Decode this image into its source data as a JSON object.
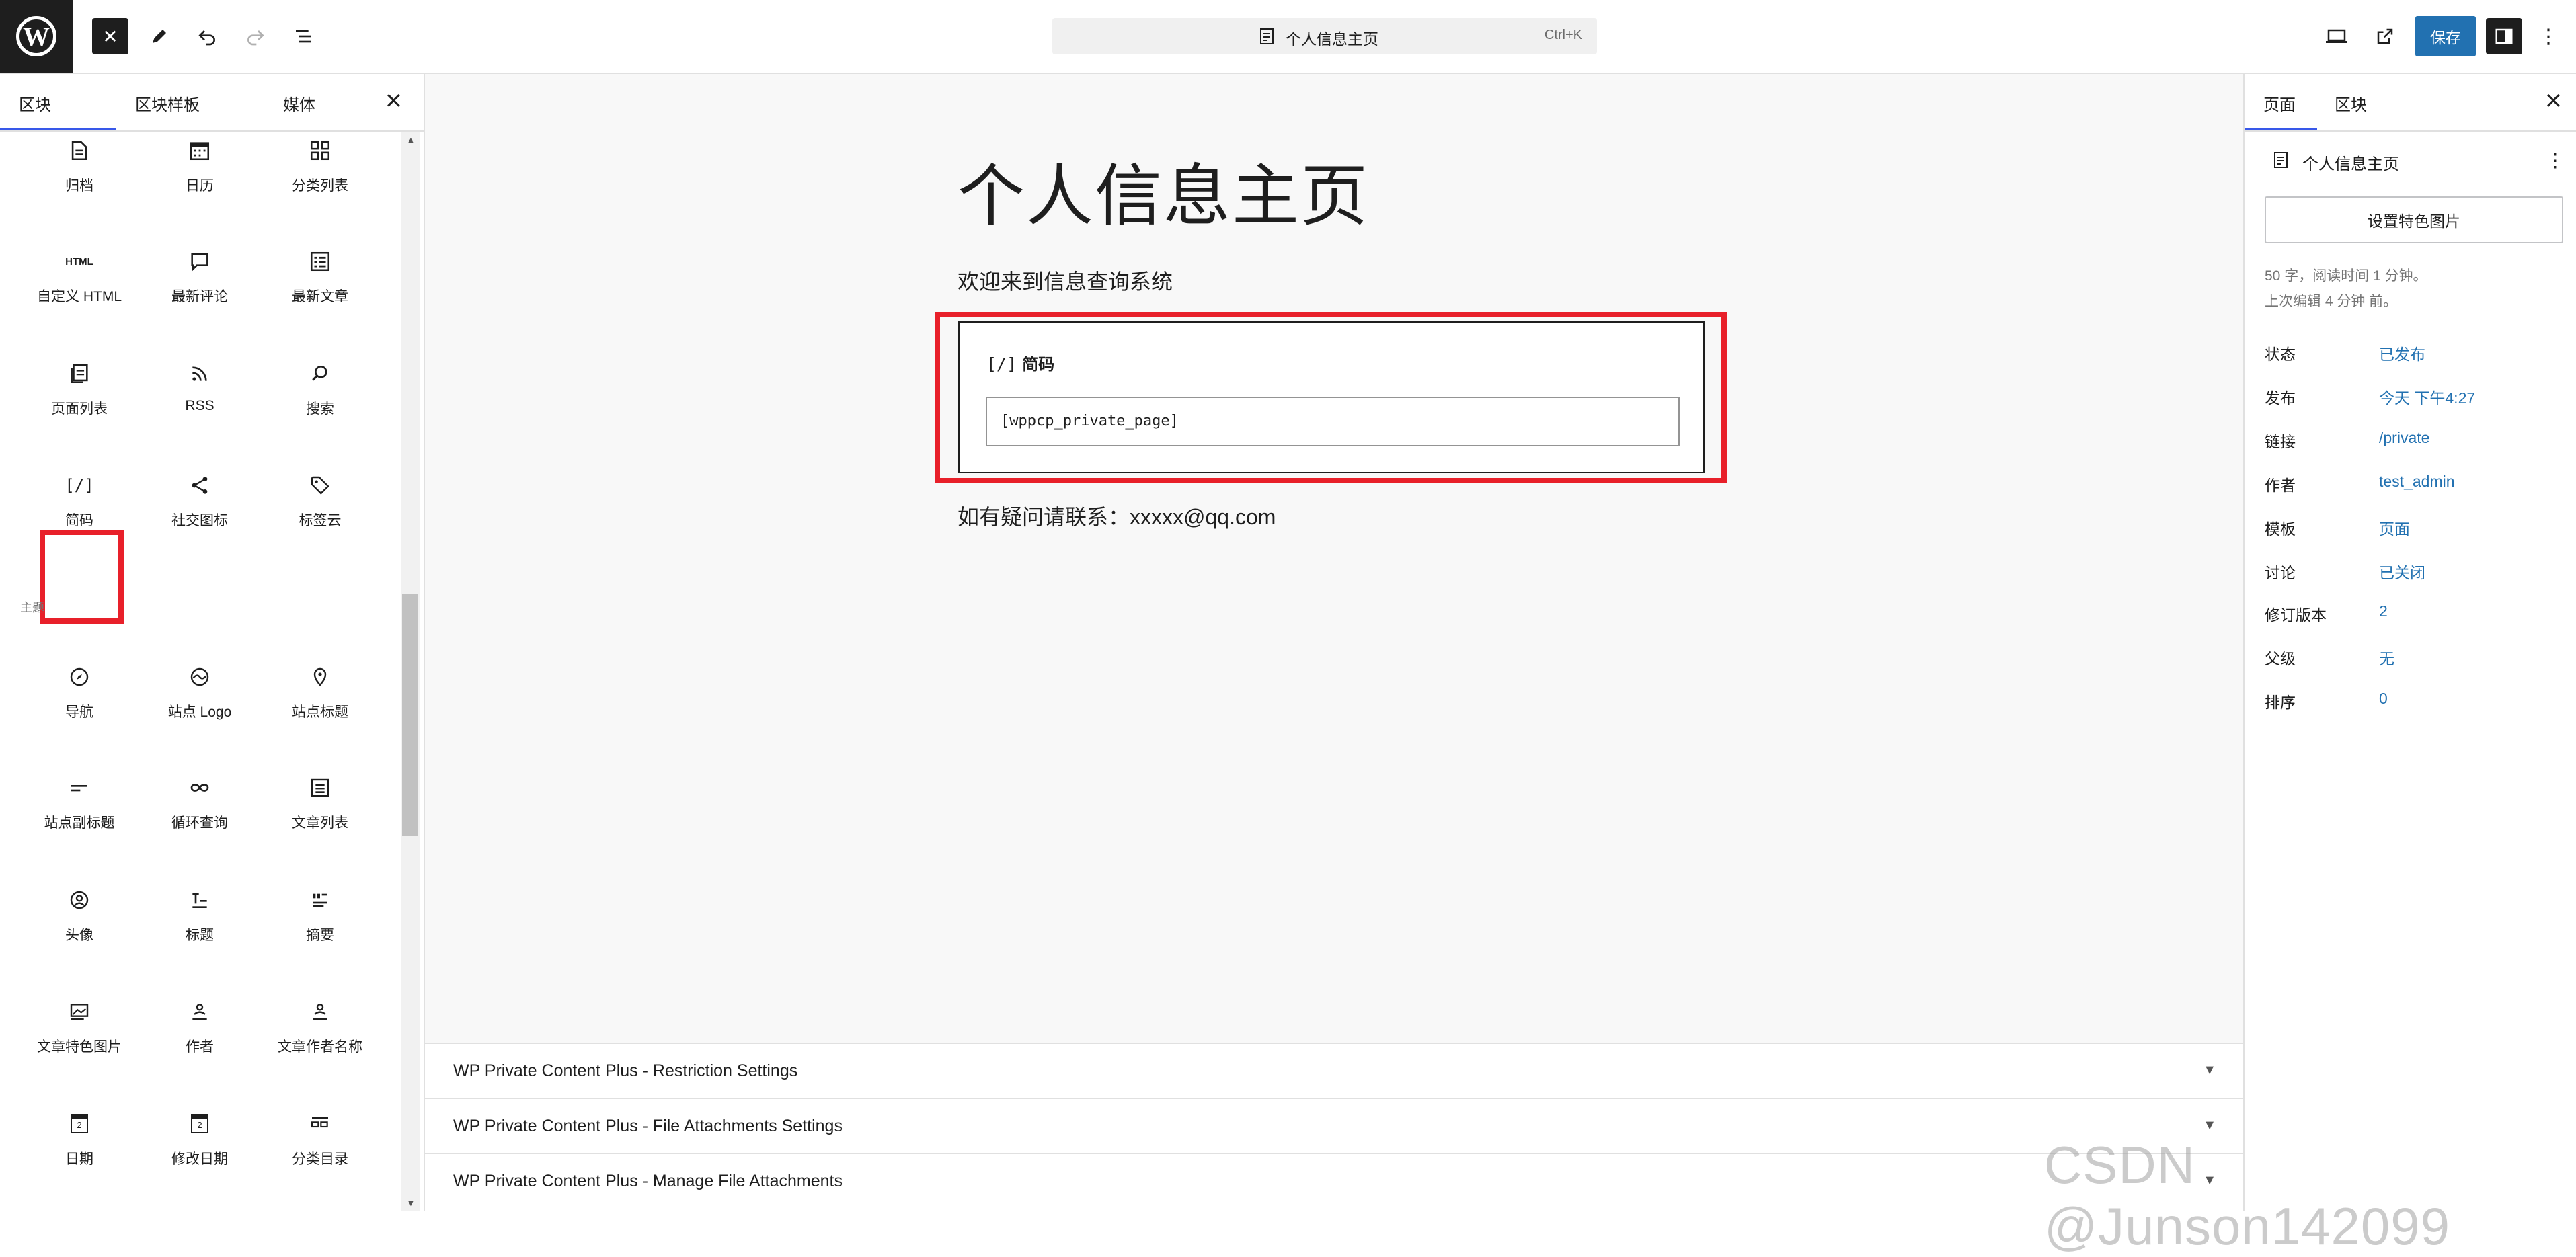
{
  "topbar": {
    "close_glyph": "✕",
    "command": {
      "title": "个人信息主页",
      "shortcut": "Ctrl+K"
    },
    "save_label": "保存"
  },
  "inserter": {
    "tabs": [
      "区块",
      "区块样板",
      "媒体"
    ],
    "close_glyph": "✕",
    "category_theme": "主题",
    "widgets": [
      {
        "label": "归档",
        "icon": "archive-icon"
      },
      {
        "label": "日历",
        "icon": "calendar-icon"
      },
      {
        "label": "分类列表",
        "icon": "categories-icon"
      },
      {
        "label": "自定义 HTML",
        "icon": "html-icon",
        "icon_text": "HTML"
      },
      {
        "label": "最新评论",
        "icon": "comment-icon"
      },
      {
        "label": "最新文章",
        "icon": "latest-posts-icon"
      },
      {
        "label": "页面列表",
        "icon": "page-list-icon"
      },
      {
        "label": "RSS",
        "icon": "rss-icon"
      },
      {
        "label": "搜索",
        "icon": "search-icon"
      },
      {
        "label": "简码",
        "icon": "shortcode-icon",
        "icon_text": "[/]"
      },
      {
        "label": "社交图标",
        "icon": "share-icon"
      },
      {
        "label": "标签云",
        "icon": "tag-icon"
      }
    ],
    "theme_blocks": [
      {
        "label": "导航",
        "icon": "navigation-icon"
      },
      {
        "label": "站点 Logo",
        "icon": "site-logo-icon"
      },
      {
        "label": "站点标题",
        "icon": "map-marker-icon"
      },
      {
        "label": "站点副标题",
        "icon": "tagline-icon"
      },
      {
        "label": "循环查询",
        "icon": "loop-icon"
      },
      {
        "label": "文章列表",
        "icon": "post-list-icon"
      },
      {
        "label": "头像",
        "icon": "avatar-icon"
      },
      {
        "label": "标题",
        "icon": "title-icon"
      },
      {
        "label": "摘要",
        "icon": "excerpt-icon"
      },
      {
        "label": "文章特色图片",
        "icon": "featured-image-icon"
      },
      {
        "label": "作者",
        "icon": "author-icon"
      },
      {
        "label": "文章作者名称",
        "icon": "author-name-icon"
      },
      {
        "label": "日期",
        "icon": "date-icon",
        "icon_text": "2"
      },
      {
        "label": "修改日期",
        "icon": "modified-date-icon",
        "icon_text": "2"
      },
      {
        "label": "分类目录",
        "icon": "terms-icon"
      }
    ]
  },
  "canvas": {
    "title": "个人信息主页",
    "welcome": "欢迎来到信息查询系统",
    "shortcode_block": {
      "icon_text": "[/]",
      "heading": "简码",
      "value": "[wppcp_private_page]"
    },
    "contact": "如有疑问请联系：xxxxx@qq.com"
  },
  "metaboxes": [
    "WP Private Content Plus - Restriction Settings",
    "WP Private Content Plus - File Attachments Settings",
    "WP Private Content Plus - Manage File Attachments"
  ],
  "sidebar": {
    "tabs": [
      "页面",
      "区块"
    ],
    "close_glyph": "✕",
    "page_title": "个人信息主页",
    "more_glyph": "⋮",
    "featured_button": "设置特色图片",
    "meta_words": "50 字，阅读时间 1 分钟。",
    "meta_edited": "上次编辑 4 分钟 前。",
    "rows": [
      {
        "key": "状态",
        "value": "已发布"
      },
      {
        "key": "发布",
        "value": "今天 下午4:27"
      },
      {
        "key": "链接",
        "value": "/private"
      },
      {
        "key": "作者",
        "value": "test_admin"
      },
      {
        "key": "模板",
        "value": "页面"
      },
      {
        "key": "讨论",
        "value": "已关闭"
      },
      {
        "key": "修订版本",
        "value": "2"
      },
      {
        "key": "父级",
        "value": "无"
      },
      {
        "key": "排序",
        "value": "0"
      }
    ]
  },
  "watermark": "CSDN @Junson142099",
  "colors": {
    "accent": "#3858e9",
    "save": "#2271b1",
    "highlight": "#e8202a",
    "link": "#2271b1"
  }
}
